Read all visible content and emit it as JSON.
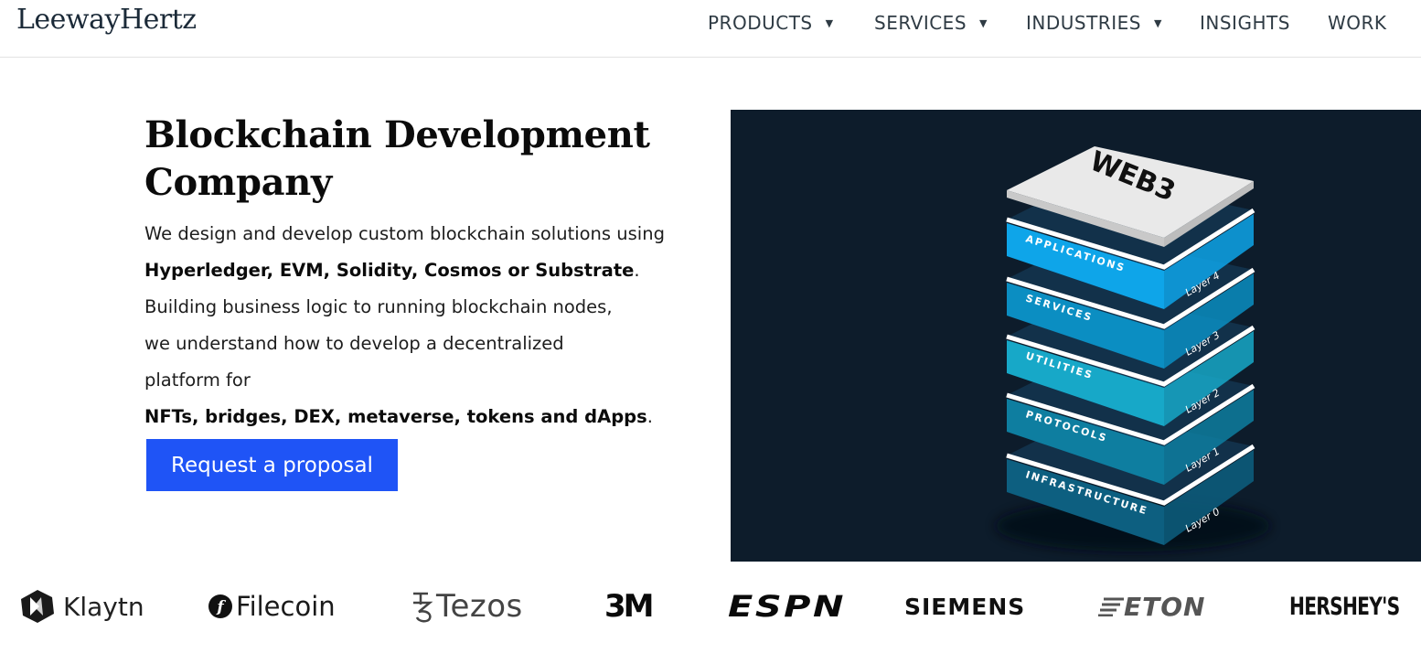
{
  "header": {
    "logo": "LeewayHertz",
    "nav": [
      {
        "label": "PRODUCTS",
        "has_dropdown": true
      },
      {
        "label": "SERVICES",
        "has_dropdown": true
      },
      {
        "label": "INDUSTRIES",
        "has_dropdown": true
      },
      {
        "label": "INSIGHTS",
        "has_dropdown": false
      },
      {
        "label": "WORK",
        "has_dropdown": false
      }
    ]
  },
  "hero": {
    "title": "Blockchain Development Company",
    "desc_1": "We design and develop custom blockchain solutions using",
    "desc_bold_1": "Hyperledger, EVM, Solidity, Cosmos or Substrate",
    "desc_2": ".",
    "desc_3": "Building business logic to running blockchain nodes, we understand how to develop a decentralized platform for",
    "desc_bold_2": "NFTs, bridges, DEX, metaverse, tokens and dApps",
    "desc_4": ".",
    "cta_label": "Request a proposal"
  },
  "illustration": {
    "top_label": "WEB3",
    "layers": [
      {
        "name": "APPLICATIONS",
        "layer": "Layer 4",
        "color": "#0ea5e9"
      },
      {
        "name": "SERVICES",
        "layer": "Layer 3",
        "color": "#0b8ec2"
      },
      {
        "name": "UTILITIES",
        "layer": "Layer 2",
        "color": "#17a8c8"
      },
      {
        "name": "PROTOCOLS",
        "layer": "Layer 1",
        "color": "#0e7ea0"
      },
      {
        "name": "INFRASTRUCTURE",
        "layer": "Layer 0",
        "color": "#0d5f80"
      }
    ],
    "background": "#0d1c2b"
  },
  "logos": [
    {
      "name": "Klaytn",
      "icon": "klaytn-logo"
    },
    {
      "name": "Filecoin",
      "icon": "filecoin-logo"
    },
    {
      "name": "Tezos",
      "icon": "tezos-logo"
    },
    {
      "name": "3M",
      "icon": "3m-logo"
    },
    {
      "name": "ESPN",
      "icon": "espn-logo"
    },
    {
      "name": "SIEMENS",
      "icon": "siemens-logo"
    },
    {
      "name": "ETON",
      "icon": "eton-logo"
    },
    {
      "name": "HERSHEY'S",
      "icon": "hersheys-logo"
    }
  ],
  "colors": {
    "accent": "#1f54f6",
    "text": "#1d1d1d",
    "nav_text": "#2f3b44"
  }
}
